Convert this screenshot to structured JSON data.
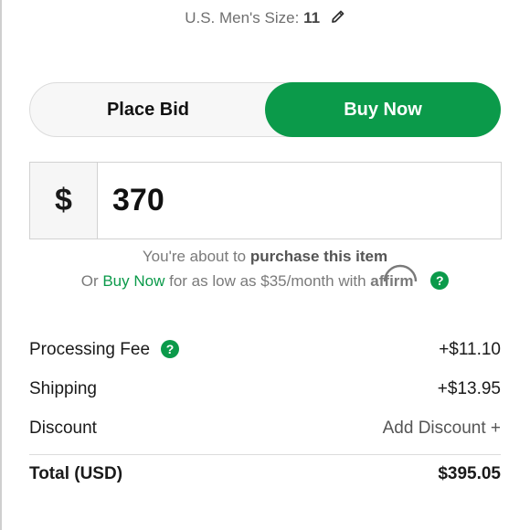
{
  "size": {
    "label": "U.S. Men's Size:",
    "value": "11",
    "edit_icon": "pencil-icon"
  },
  "toggle": {
    "place_bid": "Place Bid",
    "buy_now": "Buy Now",
    "active": "buy_now",
    "active_color": "#0b9a4a"
  },
  "price": {
    "currency": "$",
    "amount": "370"
  },
  "info": {
    "line1_prefix": "You're about to",
    "line1_bold": "purchase this item",
    "line2_prefix": "Or",
    "line2_link": "Buy Now",
    "line2_suffix": "for as low as $35/month with",
    "affirm": "affirm",
    "help_icon": "question-circle-icon"
  },
  "fees": {
    "processing_label": "Processing Fee",
    "processing_value": "+$11.10",
    "shipping_label": "Shipping",
    "shipping_value": "+$13.95",
    "discount_label": "Discount",
    "discount_action": "Add Discount +",
    "total_label": "Total (USD)",
    "total_value": "$395.05"
  },
  "help_glyph": "?"
}
